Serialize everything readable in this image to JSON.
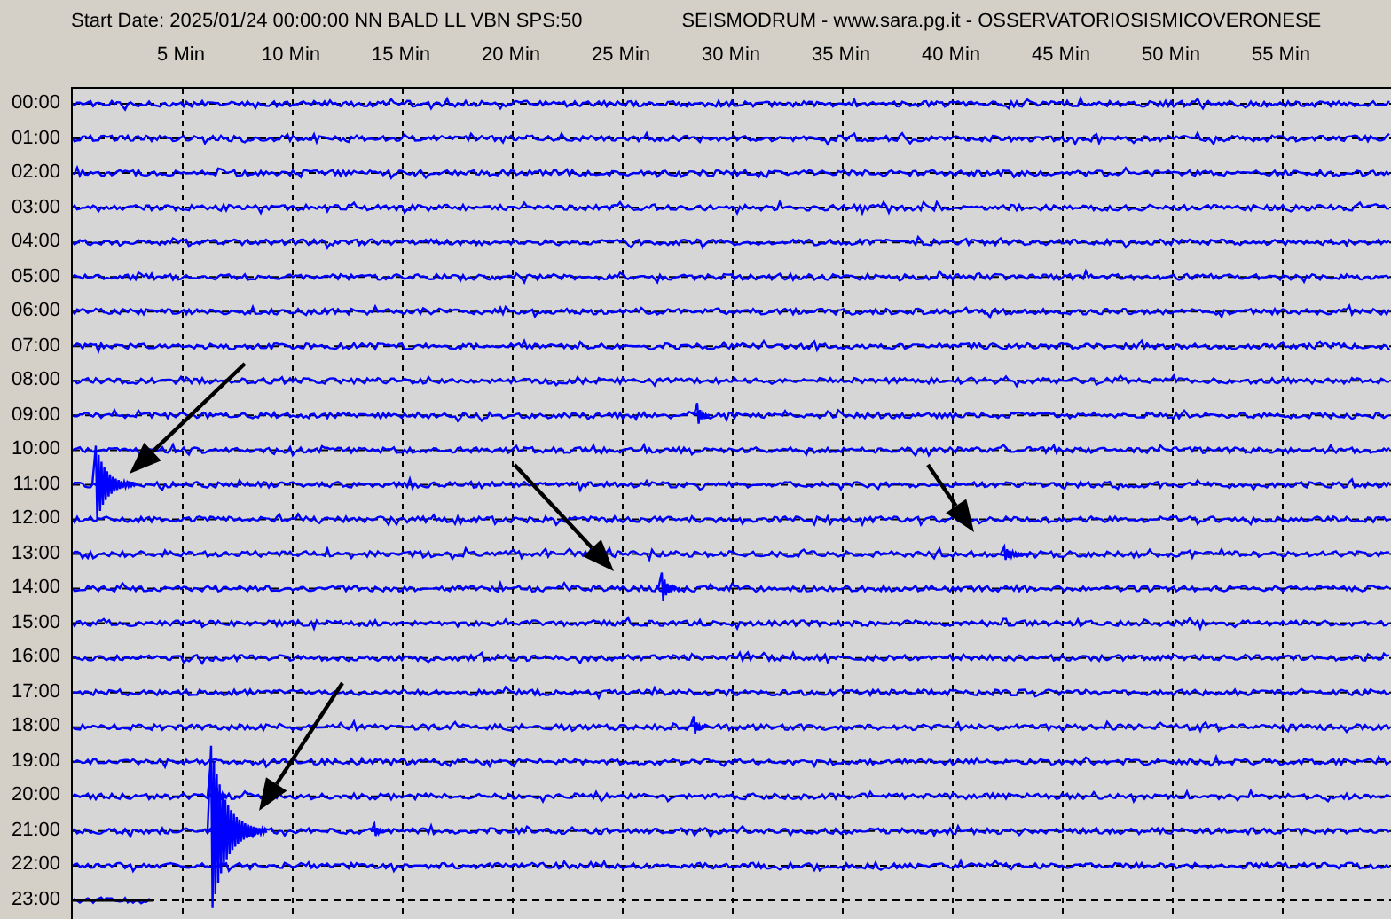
{
  "header": {
    "title": "Start Date: 2025/01/24 00:00:00 NN BALD LL VBN SPS:50",
    "source": "SEISMODRUM - www.sara.pg.it - OSSERVATORIOSISMICOVERONESE"
  },
  "minute_labels": [
    "5 Min",
    "10 Min",
    "15 Min",
    "20 Min",
    "25 Min",
    "30 Min",
    "35 Min",
    "40 Min",
    "45 Min",
    "50 Min",
    "55 Min"
  ],
  "hour_labels": [
    "00:00",
    "01:00",
    "02:00",
    "03:00",
    "04:00",
    "05:00",
    "06:00",
    "07:00",
    "08:00",
    "09:00",
    "10:00",
    "11:00",
    "12:00",
    "13:00",
    "14:00",
    "15:00",
    "16:00",
    "17:00",
    "18:00",
    "19:00",
    "20:00",
    "21:00",
    "22:00",
    "23:00"
  ]
}
